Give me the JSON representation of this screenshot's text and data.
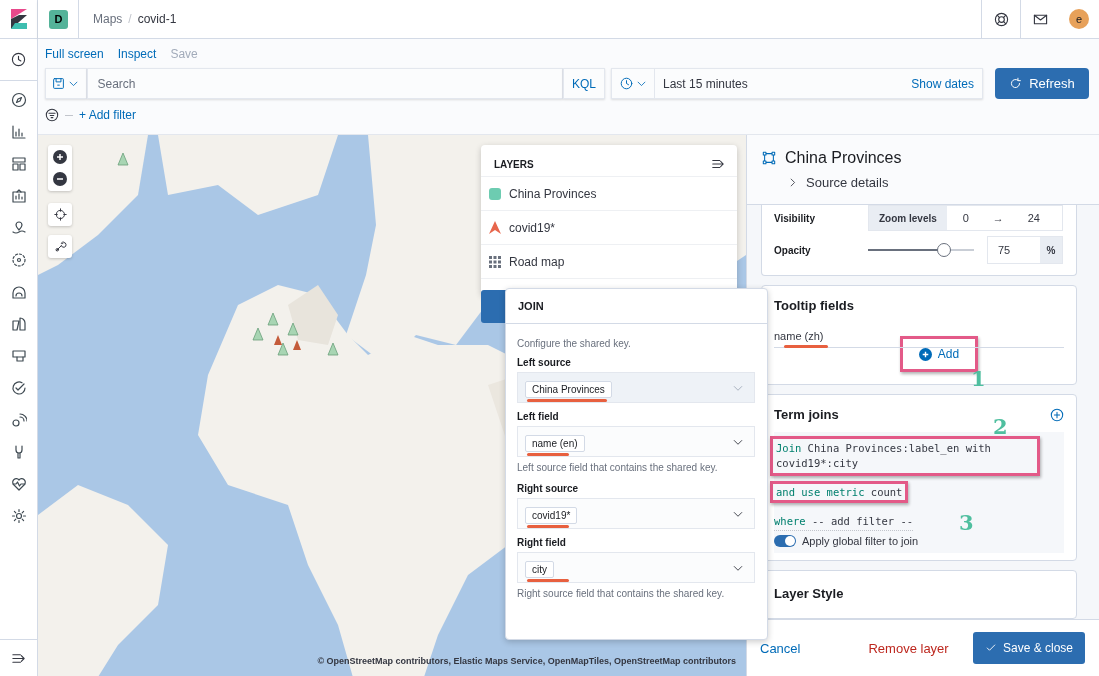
{
  "header": {
    "space_badge": "D",
    "breadcrumbs": [
      "Maps",
      "covid-1"
    ],
    "separator": "/",
    "avatar": "e"
  },
  "top_nav": [
    {
      "label": "Full screen",
      "disabled": false
    },
    {
      "label": "Inspect",
      "disabled": false
    },
    {
      "label": "Save",
      "disabled": true
    }
  ],
  "query_bar": {
    "placeholder": "Search",
    "language": "KQL",
    "time_range": "Last 15 minutes",
    "show_dates": "Show dates",
    "refresh": "Refresh"
  },
  "filter_bar": {
    "add_filter": "+ Add filter"
  },
  "layers_panel": {
    "title": "LAYERS",
    "layers": [
      {
        "name": "China Provinces",
        "kind": "polygon",
        "color": "#6dccb1"
      },
      {
        "name": "covid19*",
        "kind": "point",
        "color": "#e7664c"
      },
      {
        "name": "Road map",
        "kind": "tiles"
      }
    ]
  },
  "join_popover": {
    "title": "JOIN",
    "description": "Configure the shared key.",
    "fields": [
      {
        "label": "Left source",
        "value": "China Provinces",
        "disabled": true
      },
      {
        "label": "Left field",
        "value": "name (en)",
        "disabled": false,
        "help": "Left source field that contains the shared key."
      },
      {
        "label": "Right source",
        "value": "covid19*",
        "disabled": false
      },
      {
        "label": "Right field",
        "value": "city",
        "disabled": false,
        "help": "Right source field that contains the shared key."
      }
    ]
  },
  "attribution": "© OpenStreetMap contributors, Elastic Maps Service, OpenMapTiles, OpenStreetMap contributors",
  "layer_panel": {
    "title": "China Provinces",
    "source_details": "Source details",
    "visibility": {
      "label": "Visibility",
      "zoom_label": "Zoom levels",
      "min": "0",
      "arrow": "→",
      "max": "24"
    },
    "opacity": {
      "label": "Opacity",
      "level": 0.72,
      "value": "75",
      "unit": "%"
    },
    "tooltip": {
      "title": "Tooltip fields",
      "fields": [
        "name (zh)"
      ],
      "add": "Add"
    },
    "term_joins": {
      "title": "Term joins",
      "join_keyword": "Join",
      "join_text": "China Provinces:label_en with covid19*:city",
      "metric_keyword": "and use metric",
      "metric": "count",
      "filter_keyword": "where",
      "filter": "-- add filter --",
      "global_filter": {
        "label": "Apply global filter to join",
        "on": true
      }
    },
    "layer_style": {
      "title": "Layer Style"
    },
    "footer": {
      "cancel": "Cancel",
      "remove": "Remove layer",
      "save": "Save & close"
    }
  },
  "annotations": [
    "1",
    "2",
    "3"
  ]
}
